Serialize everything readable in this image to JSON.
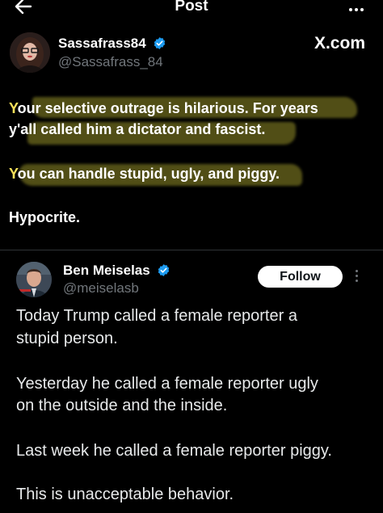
{
  "header": {
    "title": "Post"
  },
  "post": {
    "author_name": "Sassafrass84",
    "author_handle": "@Sassafrass_84",
    "platform_label": "X.com",
    "lines": [
      {
        "first": "Y",
        "rest": "our selective outrage is hilarious. For years"
      },
      {
        "first": "",
        "rest": "y'all called him a dictator and fascist."
      },
      {
        "first": "Y",
        "rest": "ou can handle stupid, ugly, and piggy."
      },
      {
        "first": "",
        "rest": "Hypocrite."
      }
    ]
  },
  "quoted": {
    "author_name": "Ben Meiselas",
    "author_handle": "@meiselasb",
    "follow_label": "Follow",
    "lines": [
      "Today Trump called a female reporter a",
      "stupid person.",
      "Yesterday he called a female reporter ugly",
      "on the outside and the inside.",
      "Last week he called a female reporter piggy.",
      "This is unacceptable behavior."
    ]
  },
  "colors": {
    "background": "#000000",
    "verified_blue": "#1d9bf0",
    "highlight": "#d4ce3a",
    "muted_text": "#71767b"
  },
  "icons": [
    "back-arrow-icon",
    "more-icon",
    "verified-badge-icon"
  ]
}
